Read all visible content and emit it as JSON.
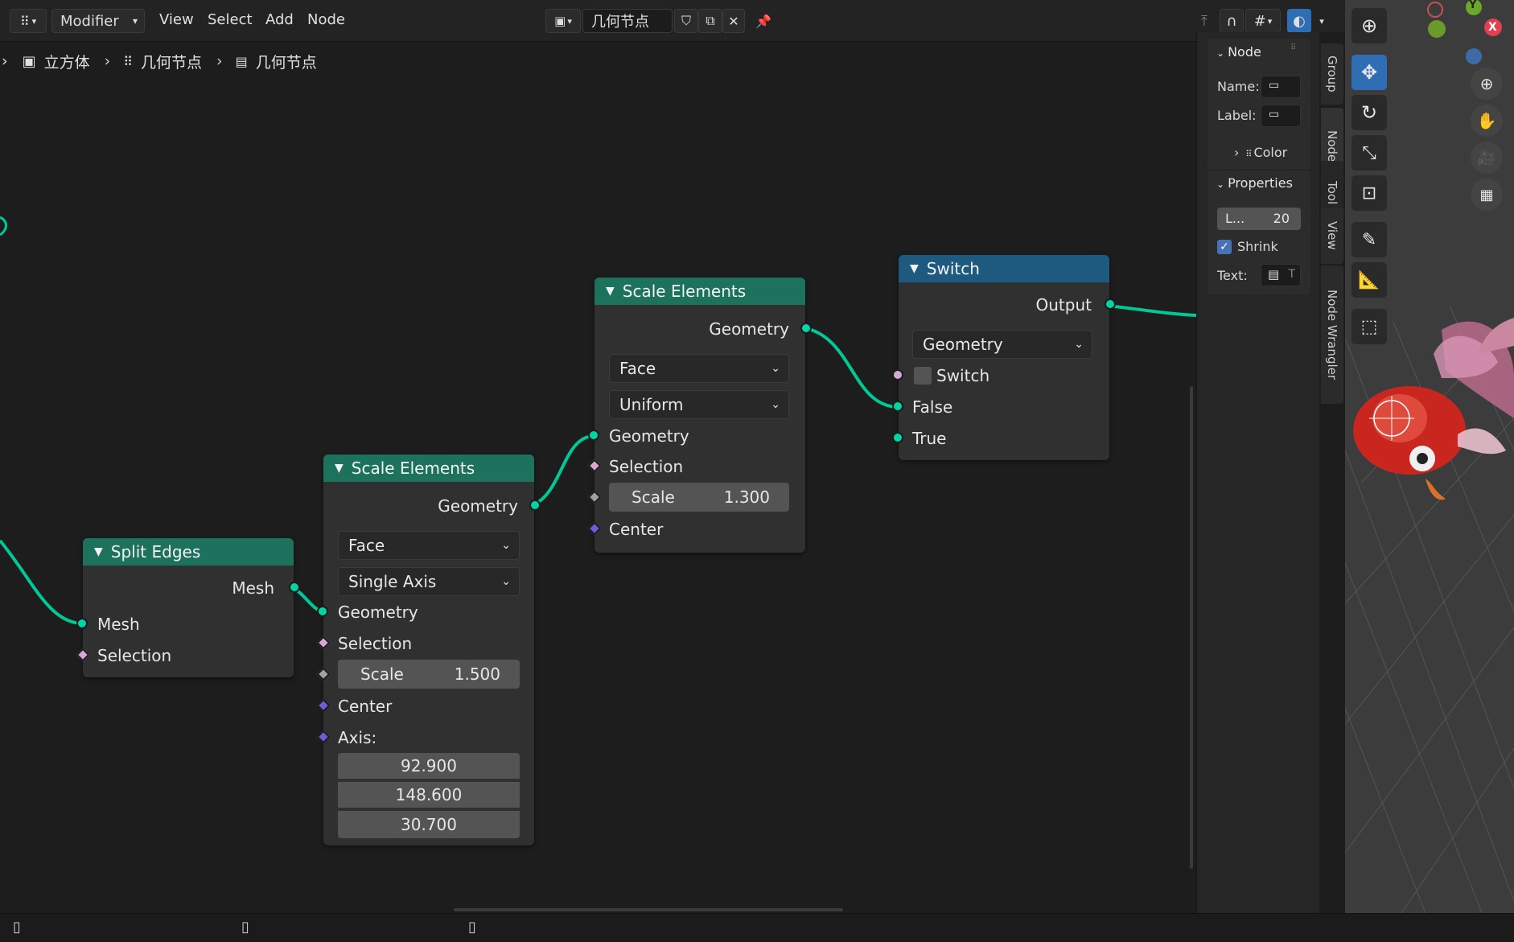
{
  "header": {
    "editor_type_label": "Modifier",
    "menus": [
      "View",
      "Select",
      "Add",
      "Node"
    ],
    "tree_name": "几何节点"
  },
  "breadcrumb": [
    "立方体",
    "几何节点",
    "几何节点"
  ],
  "nodes": {
    "split_edges": {
      "title": "Split Edges",
      "output": "Mesh",
      "inputs": [
        "Mesh",
        "Selection"
      ]
    },
    "scale_a": {
      "title": "Scale Elements",
      "output": "Geometry",
      "domain": "Face",
      "mode": "Single Axis",
      "inputs": [
        "Geometry",
        "Selection"
      ],
      "scale_label": "Scale",
      "scale_value": "1.500",
      "center": "Center",
      "axis_label": "Axis:",
      "axis": [
        "92.900",
        "148.600",
        "30.700"
      ]
    },
    "scale_b": {
      "title": "Scale Elements",
      "output": "Geometry",
      "domain": "Face",
      "mode": "Uniform",
      "inputs": [
        "Geometry",
        "Selection"
      ],
      "scale_label": "Scale",
      "scale_value": "1.300",
      "center": "Center"
    },
    "switch": {
      "title": "Switch",
      "output": "Output",
      "type": "Geometry",
      "switch_label": "Switch",
      "false_label": "False",
      "true_label": "True"
    }
  },
  "sidebar": {
    "node_panel": "Node",
    "name_label": "Name:",
    "label_label": "Label:",
    "color_label": "Color",
    "properties_panel": "Properties",
    "prop_field_label": "L...",
    "prop_field_value": "20",
    "shrink_label": "Shrink",
    "text_label": "Text:",
    "text_hint": "T",
    "tabs": [
      "Group",
      "Node",
      "Tool",
      "View",
      "Node Wrangler"
    ]
  },
  "viewport": {
    "axis_x": "X",
    "axis_y": "Y"
  },
  "colors": {
    "geometry_socket": "#00d6a3",
    "node_header_geometry": "#1d725e",
    "node_header_switch": "#1e5a80",
    "accent": "#2f6db5"
  }
}
